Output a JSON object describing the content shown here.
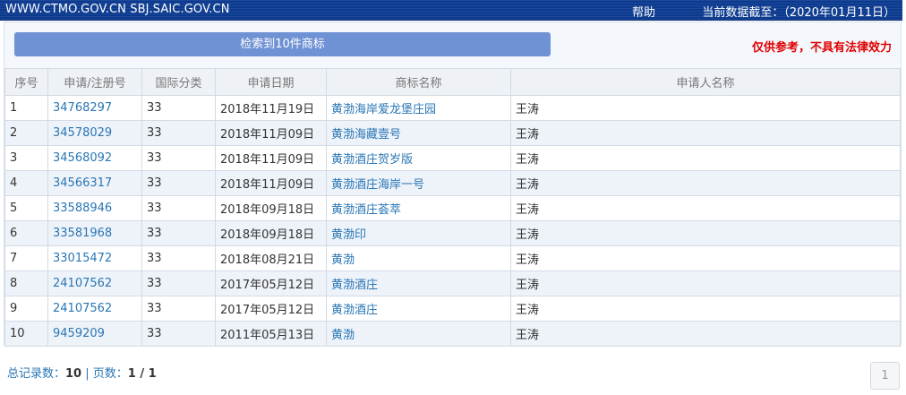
{
  "topbar": {
    "sites": "WWW.CTMO.GOV.CN SBJ.SAIC.GOV.CN",
    "help": "帮助",
    "data_date": "当前数据截至：（2020年01月11日）"
  },
  "search_summary": "检索到10件商标",
  "disclaimer": "仅供参考，不具有法律效力",
  "table": {
    "headers": [
      "序号",
      "申请/注册号",
      "国际分类",
      "申请日期",
      "商标名称",
      "申请人名称"
    ],
    "rows": [
      [
        "1",
        "34768297",
        "33",
        "2018年11月19日",
        "黄渤海岸爱龙堡庄园",
        "王涛"
      ],
      [
        "2",
        "34578029",
        "33",
        "2018年11月09日",
        "黄渤海藏壹号",
        "王涛"
      ],
      [
        "3",
        "34568092",
        "33",
        "2018年11月09日",
        "黄渤酒庄贺岁版",
        "王涛"
      ],
      [
        "4",
        "34566317",
        "33",
        "2018年11月09日",
        "黄渤酒庄海岸一号",
        "王涛"
      ],
      [
        "5",
        "33588946",
        "33",
        "2018年09月18日",
        "黄渤酒庄荟萃",
        "王涛"
      ],
      [
        "6",
        "33581968",
        "33",
        "2018年09月18日",
        "黄渤印",
        "王涛"
      ],
      [
        "7",
        "33015472",
        "33",
        "2018年08月21日",
        "黄渤",
        "王涛"
      ],
      [
        "8",
        "24107562",
        "33",
        "2017年05月12日",
        "黄渤酒庄",
        "王涛"
      ],
      [
        "9",
        "24107562",
        "33",
        "2017年05月12日",
        "黄渤酒庄",
        "王涛"
      ],
      [
        "10",
        "9459209",
        "33",
        "2011年05月13日",
        "黄渤",
        "王涛"
      ]
    ]
  },
  "footer": {
    "total_label": "总记录数：",
    "total_value": "10",
    "separator": " | ",
    "pages_label": "页数：",
    "pages_value": "1 / 1"
  },
  "pager": {
    "page": "1"
  }
}
